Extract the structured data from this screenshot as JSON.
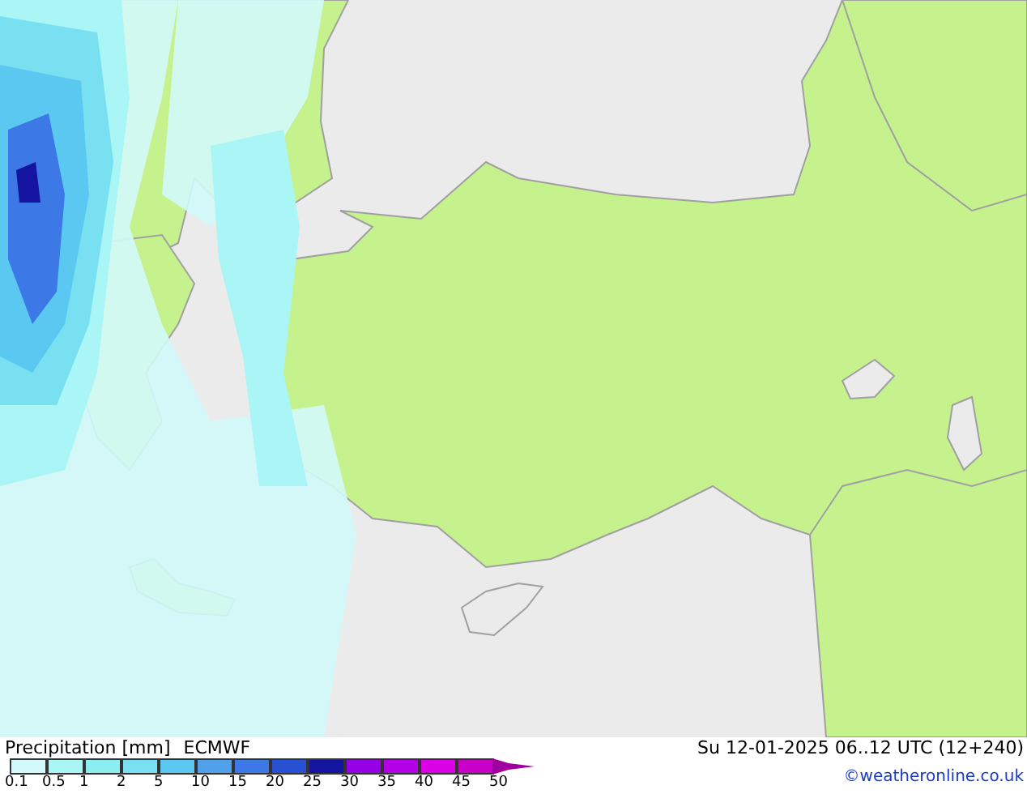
{
  "legend": {
    "title": "Precipitation [mm]",
    "model": "ECMWF",
    "valid_time": "Su 12-01-2025 06..12 UTC (12+240)",
    "credit": "©weatheronline.co.uk",
    "scale": [
      {
        "label": "0.1",
        "color": "#d2fafa"
      },
      {
        "label": "0.5",
        "color": "#aaf5f5"
      },
      {
        "label": "1",
        "color": "#8ceef0"
      },
      {
        "label": "2",
        "color": "#78e0f0"
      },
      {
        "label": "5",
        "color": "#5ac8f0"
      },
      {
        "label": "10",
        "color": "#50a0eb"
      },
      {
        "label": "15",
        "color": "#3c78e6"
      },
      {
        "label": "20",
        "color": "#2850d2"
      },
      {
        "label": "25",
        "color": "#1414a0"
      },
      {
        "label": "30",
        "color": "#9600e6"
      },
      {
        "label": "35",
        "color": "#b400e6"
      },
      {
        "label": "40",
        "color": "#dc00e6"
      },
      {
        "label": "45",
        "color": "#c800c8"
      },
      {
        "label": "50",
        "color": "#a000a0"
      }
    ]
  }
}
